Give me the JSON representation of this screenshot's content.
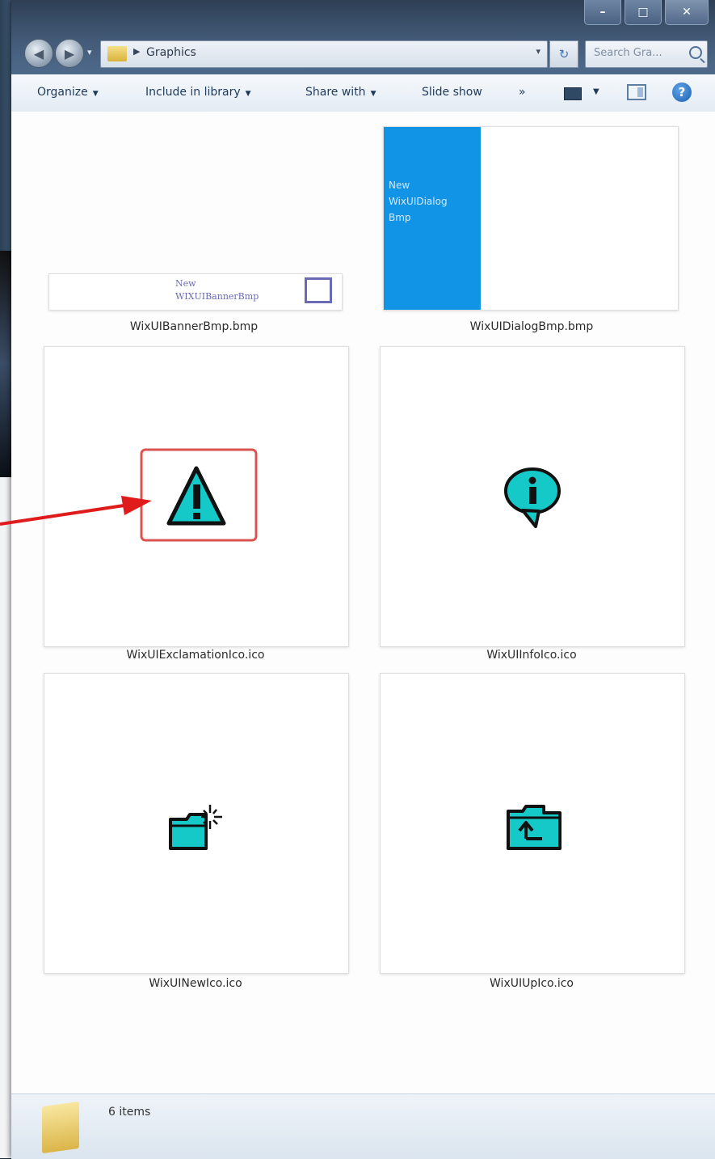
{
  "window": {
    "address_path": "Graphics",
    "search_placeholder": "Search Gra...",
    "caption_buttons": {
      "minimize": "–",
      "maximize": "□",
      "close": "✕"
    }
  },
  "toolbar": {
    "organize": "Organize",
    "include_in_library": "Include in library",
    "share_with": "Share with",
    "slide_show": "Slide show",
    "more": "»",
    "help": "?"
  },
  "files": [
    {
      "name": "WixUIBannerBmp.bmp",
      "thumb_text": [
        "New",
        "WIXUIBannerBmp"
      ]
    },
    {
      "name": "WixUIDialogBmp.bmp",
      "thumb_text": [
        "New",
        "WixUIDialog",
        "Bmp"
      ]
    },
    {
      "name": "WixUIExclamationIco.ico",
      "icon": "warning-exclamation-icon",
      "highlighted": true
    },
    {
      "name": "WixUIInfoIco.ico",
      "icon": "info-bubble-icon"
    },
    {
      "name": "WixUINewIco.ico",
      "icon": "new-folder-icon"
    },
    {
      "name": "WixUIUpIco.ico",
      "icon": "folder-up-icon"
    }
  ],
  "status": {
    "item_count": "6 items"
  },
  "colors": {
    "icon_teal": "#16c9c9",
    "highlight_red": "#d9534f",
    "arrow_red": "#e01b1b",
    "dialog_blue": "#1294e6",
    "toolbar_text": "#1f3a5c"
  }
}
